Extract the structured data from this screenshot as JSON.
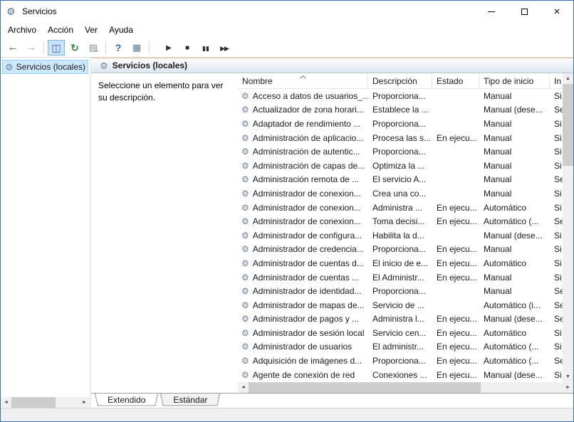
{
  "window": {
    "title": "Servicios",
    "controls": [
      "minimize",
      "maximize",
      "close"
    ]
  },
  "colors": {
    "window_border": "#4070b4",
    "selection_fill": "#cce8ff",
    "selection_border": "#99d1ff",
    "banner_accent": "#ecc089"
  },
  "menu": {
    "items": [
      {
        "label": "Archivo"
      },
      {
        "label": "Acción"
      },
      {
        "label": "Ver"
      },
      {
        "label": "Ayuda"
      }
    ]
  },
  "toolbar": {
    "icons": [
      "back",
      "forward",
      "show-console-tree",
      "refresh",
      "export-list",
      "help",
      "properties",
      "start-service",
      "stop-service",
      "pause-service",
      "restart-service"
    ]
  },
  "sidebar": {
    "items": [
      {
        "label": "Servicios (locales)",
        "selected": true
      }
    ]
  },
  "main": {
    "banner": {
      "title": "Servicios (locales)"
    },
    "description_pane": {
      "text": "Seleccione un elemento para ver su descripción."
    },
    "table": {
      "columns": [
        "Nombre",
        "Descripción",
        "Estado",
        "Tipo de inicio",
        "In"
      ],
      "sorted_column": "Nombre",
      "sort_direction": "asc",
      "rows": [
        {
          "name": "Acceso a datos de usuarios_...",
          "description": "Proporciona...",
          "status": "",
          "startup": "Manual",
          "logon": "Si"
        },
        {
          "name": "Actualizador de zona horari...",
          "description": "Establece la ...",
          "status": "",
          "startup": "Manual (dese...",
          "logon": "Se"
        },
        {
          "name": "Adaptador de rendimiento ...",
          "description": "Proporciona...",
          "status": "",
          "startup": "Manual",
          "logon": "Si"
        },
        {
          "name": "Administración de aplicacio...",
          "description": "Procesa las s...",
          "status": "En ejecu...",
          "startup": "Manual",
          "logon": "Si"
        },
        {
          "name": "Administración de autentic...",
          "description": "Proporciona...",
          "status": "",
          "startup": "Manual",
          "logon": "Si"
        },
        {
          "name": "Administración de capas de...",
          "description": "Optimiza la ...",
          "status": "",
          "startup": "Manual",
          "logon": "Si"
        },
        {
          "name": "Administración remota de ...",
          "description": "El servicio A...",
          "status": "",
          "startup": "Manual",
          "logon": "Se"
        },
        {
          "name": "Administrador de conexion...",
          "description": "Crea una co...",
          "status": "",
          "startup": "Manual",
          "logon": "Si"
        },
        {
          "name": "Administrador de conexion...",
          "description": "Administra ...",
          "status": "En ejecu...",
          "startup": "Automático",
          "logon": "Si"
        },
        {
          "name": "Administrador de conexion...",
          "description": "Toma decisi...",
          "status": "En ejecu...",
          "startup": "Automático (...",
          "logon": "Se"
        },
        {
          "name": "Administrador de configura...",
          "description": "Habilita la d...",
          "status": "",
          "startup": "Manual (dese...",
          "logon": "Si"
        },
        {
          "name": "Administrador de credencia...",
          "description": "Proporciona...",
          "status": "En ejecu...",
          "startup": "Manual",
          "logon": "Si"
        },
        {
          "name": "Administrador de cuentas d...",
          "description": "El inicio de e...",
          "status": "En ejecu...",
          "startup": "Automático",
          "logon": "Si"
        },
        {
          "name": "Administrador de cuentas ...",
          "description": "El Administr...",
          "status": "En ejecu...",
          "startup": "Manual",
          "logon": "Si"
        },
        {
          "name": "Administrador de identidad...",
          "description": "Proporciona...",
          "status": "",
          "startup": "Manual",
          "logon": "Se"
        },
        {
          "name": "Administrador de mapas de...",
          "description": "Servicio de ...",
          "status": "",
          "startup": "Automático (i...",
          "logon": "Se"
        },
        {
          "name": "Administrador de pagos y ...",
          "description": "Administra l...",
          "status": "En ejecu...",
          "startup": "Manual (dese...",
          "logon": "Se"
        },
        {
          "name": "Administrador de sesión local",
          "description": "Servicio cen...",
          "status": "En ejecu...",
          "startup": "Automático",
          "logon": "Si"
        },
        {
          "name": "Administrador de usuarios",
          "description": "El administr...",
          "status": "En ejecu...",
          "startup": "Automático (...",
          "logon": "Si"
        },
        {
          "name": "Adquisición de imágenes d...",
          "description": "Proporciona...",
          "status": "En ejecu...",
          "startup": "Automático (...",
          "logon": "Se"
        },
        {
          "name": "Agente de conexión de red",
          "description": "Conexiones ...",
          "status": "En ejecu...",
          "startup": "Manual (dese...",
          "logon": "Si"
        }
      ]
    },
    "tabs": [
      {
        "label": "Extendido",
        "active": true
      },
      {
        "label": "Estándar",
        "active": false
      }
    ]
  }
}
